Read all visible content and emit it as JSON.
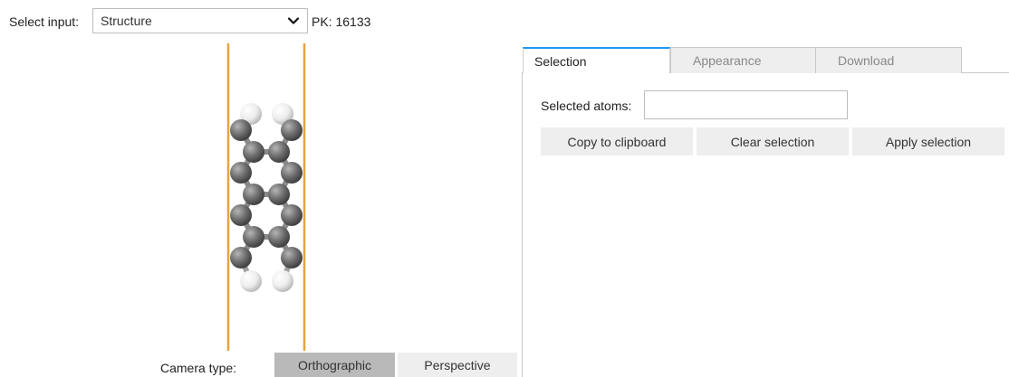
{
  "header": {
    "select_label": "Select input:",
    "select_value": "Structure",
    "pk_label": "PK: 16133"
  },
  "viewer": {
    "cell_line_color": "#e8a33c",
    "carbon_color": "#6e6e6e",
    "hydrogen_color": "#ededed",
    "camera_label": "Camera type:",
    "camera_options": [
      "Orthographic",
      "Perspective"
    ],
    "camera_selected": "Orthographic"
  },
  "panel": {
    "tabs": [
      "Selection",
      "Appearance",
      "Download"
    ],
    "active_tab": "Selection",
    "accent_color": "#2196f3",
    "selected_atoms_label": "Selected atoms:",
    "selected_atoms_value": "",
    "buttons": {
      "copy": "Copy to clipboard",
      "clear": "Clear selection",
      "apply": "Apply selection"
    }
  }
}
